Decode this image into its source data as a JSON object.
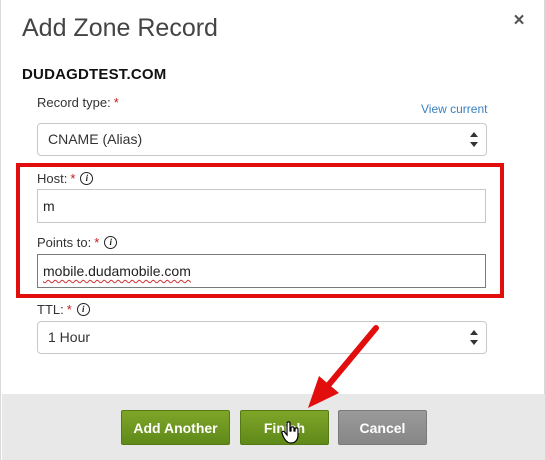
{
  "dialog": {
    "title": "Add Zone Record",
    "close_glyph": "×",
    "domain": "DUDAGDTEST.COM"
  },
  "record_type": {
    "label": "Record type:",
    "required_mark": "*",
    "view_current": "View current",
    "value": "CNAME (Alias)"
  },
  "host": {
    "label": "Host:",
    "required_mark": "*",
    "value": "m"
  },
  "points_to": {
    "label": "Points to:",
    "required_mark": "*",
    "value": "mobile.dudamobile.com"
  },
  "ttl": {
    "label": "TTL:",
    "required_mark": "*",
    "value": "1 Hour"
  },
  "footer": {
    "add_another": "Add Another",
    "finish": "Finish",
    "cancel": "Cancel"
  },
  "colors": {
    "highlight": "#e20d0d",
    "button_green": "#6e9a22",
    "button_gray": "#8f8f8f",
    "link": "#3a7fc1",
    "required": "#c41a1a"
  },
  "icons": {
    "info": "info-icon",
    "close": "close-icon",
    "select_arrows": "select-arrows-icon",
    "annotation_arrow": "red-arrow-icon",
    "cursor": "hand-cursor-icon"
  }
}
